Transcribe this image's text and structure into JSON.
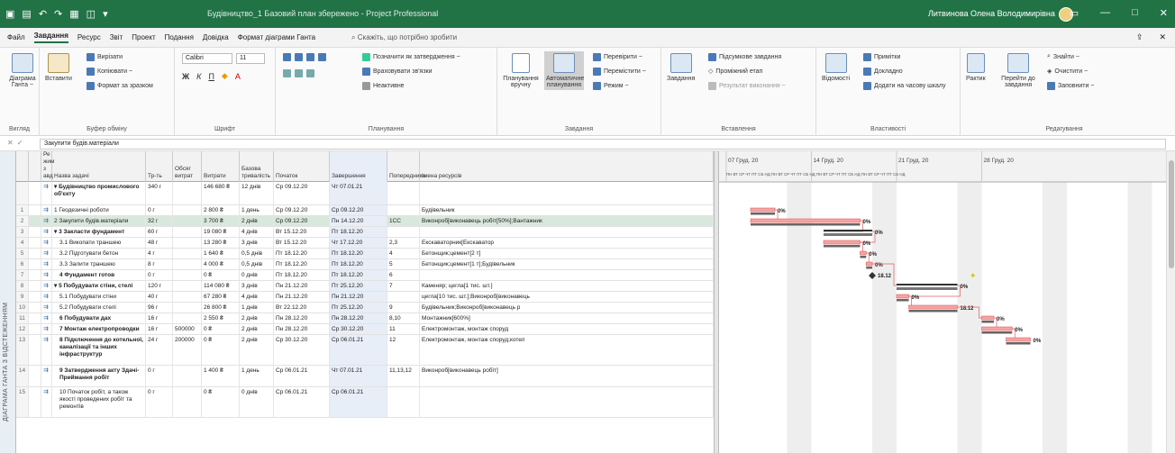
{
  "titlebar": {
    "document_title": "Будівництво_1 Базовий план збережено - Project Professional",
    "user": "Литвинова Олена Володимирівна",
    "icons": [
      "app-icon",
      "save-icon",
      "undo-icon",
      "redo-icon",
      "view-icon",
      "copy-icon",
      "dropdown-icon"
    ]
  },
  "menu": {
    "tabs": [
      "Файл",
      "Завдання",
      "Ресурс",
      "Звіт",
      "Проект",
      "Подання",
      "Довідка",
      "Формат діаграми Ганта"
    ],
    "active_tab": "Завдання",
    "search": "Скажіть, що потрібно зробити"
  },
  "ribbon": {
    "groups": [
      {
        "id": "view",
        "label": "Вигляд",
        "buttons": [
          "Діаграма Ганта ~"
        ]
      },
      {
        "id": "clipboard",
        "label": "Буфер обміну",
        "buttons": [
          "Вставити",
          "Вирізати",
          "Копіювати ~",
          "Формат за зразком"
        ]
      },
      {
        "id": "font",
        "label": "Шрифт",
        "font_name": "Calibri",
        "font_size": "11"
      },
      {
        "id": "schedule",
        "label": "Планування",
        "buttons": [
          "Позначити як затвердження ~",
          "Враховувати зв'язки",
          "Неактивне"
        ]
      },
      {
        "id": "tasks",
        "label": "Завдання",
        "buttons": [
          "Планування вручну",
          "Автоматичне планування",
          "Перевірити ~",
          "Перемістити ~",
          "Режим ~"
        ]
      },
      {
        "id": "insert",
        "label": "Вставлення",
        "buttons": [
          "Завдання",
          "Підсумкове завдання",
          "Проміжний етап",
          "Результат виконання ~"
        ]
      },
      {
        "id": "properties",
        "label": "Властивості",
        "buttons": [
          "Відомості",
          "Примітки",
          "Докладно",
          "Додати на часову шкалу"
        ]
      },
      {
        "id": "editing",
        "label": "Редагування",
        "buttons": [
          "Рактик",
          "Перейти до завдання",
          "Знайти ~",
          "Очистити ~",
          "Заповнити ~"
        ]
      }
    ]
  },
  "formula_bar": {
    "value": "Закупити будів.матеріали"
  },
  "sidebar_label": "ДІАГРАМА ГАНТА З ВІДСТЕЖЕННЯМ",
  "grid": {
    "headers": [
      "",
      "Ре\nжим з\nавд",
      "Назва задачі",
      "Тр-ть",
      "Обсяг\nвитрат",
      "Витрати",
      "Базова тривалість",
      "Початок",
      "Завершення",
      "Попередники",
      "Імена ресурсів"
    ],
    "rows": [
      {
        "id": "",
        "name": "Будівництво промислового об'єкту",
        "dur": "340 г",
        "work": "",
        "cost": "146 680 ₴",
        "base": "12 днів",
        "start": "Ср 09.12.20",
        "finish": "Чт 07.01.21",
        "pred": "",
        "res": "",
        "summary": true,
        "height": 26
      },
      {
        "id": "1",
        "name": "1 Геодезичні роботи",
        "dur": "0 г",
        "work": "",
        "cost": "2 800 ₴",
        "base": "1 день",
        "start": "Ср 09.12.20",
        "finish": "Ср 09.12.20",
        "pred": "",
        "res": "Будівельник",
        "summary": false,
        "height": 12
      },
      {
        "id": "2",
        "name": "2 Закупити будів.матеріали",
        "dur": "32 г",
        "work": "",
        "cost": "3 700 ₴",
        "base": "2 днів",
        "start": "Ср 09.12.20",
        "finish": "Пн 14.12.20",
        "pred": "1СС",
        "res": "Виконроб[виконавець робіт[50%];Вантажник",
        "summary": false,
        "height": 12,
        "selected": true
      },
      {
        "id": "3",
        "name": "3 Закласти фундамент",
        "dur": "60 г",
        "work": "",
        "cost": "19 080 ₴",
        "base": "4 днів",
        "start": "Вт 15.12.20",
        "finish": "Пт 18.12.20",
        "pred": "",
        "res": "",
        "summary": true,
        "height": 12
      },
      {
        "id": "4",
        "name": "3.1 Викопати траншею",
        "dur": "48 г",
        "work": "",
        "cost": "13 280 ₴",
        "base": "3 днів",
        "start": "Вт 15.12.20",
        "finish": "Чт 17.12.20",
        "pred": "2,3",
        "res": "Екскаваторник[Екскаватор",
        "summary": false,
        "height": 12
      },
      {
        "id": "5",
        "name": "3.2 Підготувати бетон",
        "dur": "4 г",
        "work": "",
        "cost": "1 640 ₴",
        "base": "0,5 днів",
        "start": "Пт 18.12.20",
        "finish": "Пт 18.12.20",
        "pred": "4",
        "res": "Бетонщик;цемент[2 т]",
        "summary": false,
        "height": 12
      },
      {
        "id": "6",
        "name": "3.3 Залити траншею",
        "dur": "8 г",
        "work": "",
        "cost": "4 000 ₴",
        "base": "0,5 днів",
        "start": "Пт 18.12.20",
        "finish": "Пт 18.12.20",
        "pred": "5",
        "res": "Бетонщик;цемент[1 т];Будівельник",
        "summary": false,
        "height": 12
      },
      {
        "id": "7",
        "name": "4 Фундамент готов",
        "dur": "0 г",
        "work": "",
        "cost": "0 ₴",
        "base": "0 днів",
        "start": "Пт 18.12.20",
        "finish": "Пт 18.12.20",
        "pred": "6",
        "res": "",
        "summary": false,
        "bold": true,
        "height": 12
      },
      {
        "id": "8",
        "name": "5 Побудувати стіни, стелі",
        "dur": "120 г",
        "work": "",
        "cost": "114 080 ₴",
        "base": "3 днів",
        "start": "Пн 21.12.20",
        "finish": "Пт 25.12.20",
        "pred": "7",
        "res": "Каменяр; цегла[1 тис. шт.]",
        "summary": true,
        "height": 12
      },
      {
        "id": "9",
        "name": "5.1 Побудувати стіни",
        "dur": "40 г",
        "work": "",
        "cost": "67 280 ₴",
        "base": "4 днів",
        "start": "Пн 21.12.20",
        "finish": "Пн 21.12.20",
        "pred": "",
        "res": "цегла[10 тис. шт.];Виконроб[виконавець",
        "summary": false,
        "height": 12
      },
      {
        "id": "10",
        "name": "5.2 Побудувати стелі",
        "dur": "96 г",
        "work": "",
        "cost": "26 800 ₴",
        "base": "1 днів",
        "start": "Вт 22.12.20",
        "finish": "Пт 25.12.20",
        "pred": "9",
        "res": "Будівельник;Виконроб[виконавець р",
        "summary": false,
        "height": 12
      },
      {
        "id": "11",
        "name": "6 Побудувати дах",
        "dur": "16 г",
        "work": "",
        "cost": "2 550 ₴",
        "base": "2 днів",
        "start": "Пн 28.12.20",
        "finish": "Пн 28.12.20",
        "pred": "8,10",
        "res": "Монтажник[600%]",
        "summary": false,
        "bold": true,
        "height": 12
      },
      {
        "id": "12",
        "name": "7 Монтаж електропроводки",
        "dur": "16 г",
        "work": "500000",
        "cost": "0 ₴",
        "base": "2 днів",
        "start": "Пн 28.12.20",
        "finish": "Ср 30.12.20",
        "pred": "11",
        "res": "Електромонтаж, монтаж споруд",
        "summary": false,
        "bold": true,
        "height": 12
      },
      {
        "id": "13",
        "name": "8 Підключення до котельної, каналізації та інших інфраструктур",
        "dur": "24 г",
        "work": "200000",
        "cost": "0 ₴",
        "base": "2 днів",
        "start": "Ср 30.12.20",
        "finish": "Ср 06.01.21",
        "pred": "12",
        "res": "Електромонтаж, монтаж споруд;котел",
        "summary": false,
        "bold": true,
        "height": 34
      },
      {
        "id": "14",
        "name": "9 Затвердження акту Здачі-Приймання робіт",
        "dur": "0 г",
        "work": "",
        "cost": "1 400 ₴",
        "base": "1 день",
        "start": "Ср 06.01.21",
        "finish": "Чт 07.01.21",
        "pred": "11,13,12",
        "res": "Виконроб[виконавець робіт]",
        "summary": false,
        "bold": true,
        "height": 24
      },
      {
        "id": "15",
        "name": "10 Початок робіт, а також якості проведених робіт та ремонтів",
        "dur": "0 г",
        "work": "",
        "cost": "0 ₴",
        "base": "0 днів",
        "start": "Ср 06.01.21",
        "finish": "Ср 06.01.21",
        "pred": "",
        "res": "",
        "summary": false,
        "height": 34
      }
    ]
  },
  "gantt": {
    "weeks": [
      "07 Груд. 20",
      "14 Груд. 20",
      "21 Груд. 20",
      "28 Груд. 20"
    ],
    "days_row": "ПН ВТ СР ЧТ ПТ СБ НД ПН ВТ СР ЧТ ПТ СБ НД ПН ВТ СР ЧТ ПТ СБ НД ПН ВТ СР ЧТ ПТ СБ НД",
    "labels": [
      "0%",
      "0%",
      "0%",
      "0%",
      "0%",
      "0%",
      "0%",
      "0%",
      "18.12",
      "0%",
      "0%",
      "0%",
      "0%"
    ]
  }
}
